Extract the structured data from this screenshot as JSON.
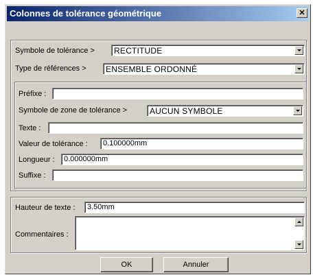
{
  "window": {
    "title": "Colonnes de tolérance géométrique",
    "close_glyph": "✕"
  },
  "top_section": {
    "tolerance_symbol": {
      "label": "Symbole de tolérance >",
      "value": "RECTITUDE"
    },
    "reference_type": {
      "label": "Type de références >",
      "value": "ENSEMBLE ORDONNÉ"
    }
  },
  "details": {
    "prefix": {
      "label": "Préfixe :",
      "value": ""
    },
    "zone_symbol": {
      "label": "Symbole de zone de tolérance >",
      "value": "AUCUN SYMBOLE"
    },
    "text": {
      "label": "Texte :",
      "value": ""
    },
    "tolerance_value": {
      "label": "Valeur de tolérance :",
      "value": "0.100000mm"
    },
    "length": {
      "label": "Longueur :",
      "value": "0.000000mm"
    },
    "suffix": {
      "label": "Suffixe :",
      "value": ""
    }
  },
  "bottom_section": {
    "text_height": {
      "label": "Hauteur de texte :",
      "value": "3.50mm"
    },
    "comments": {
      "label": "Commentaires :",
      "value": ""
    }
  },
  "buttons": {
    "ok": "OK",
    "cancel": "Annuler"
  }
}
